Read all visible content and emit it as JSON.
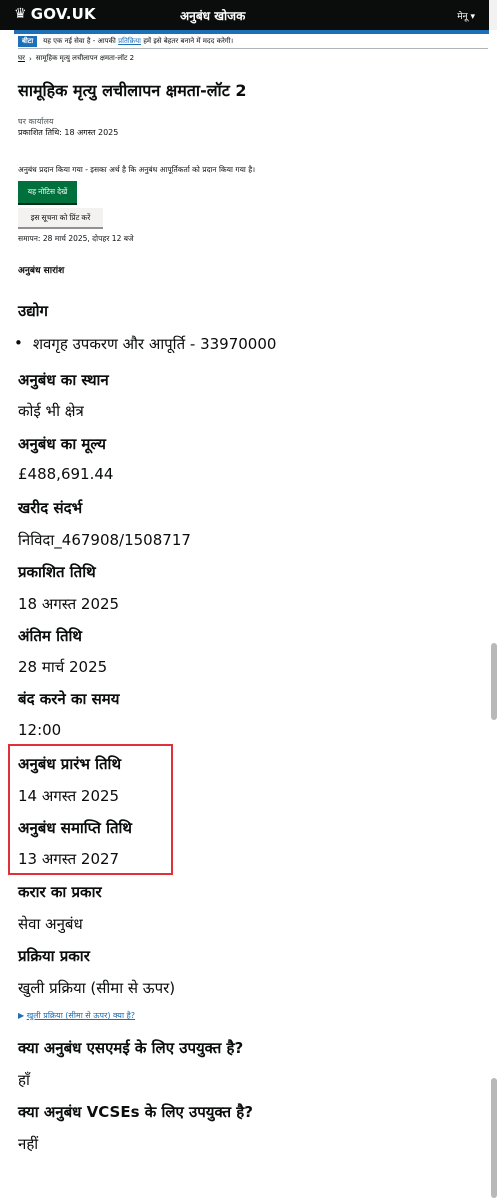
{
  "header": {
    "brand": "GOV.UK",
    "service": "अनुबंध खोजक",
    "menu_label": "मेनू"
  },
  "beta_banner": {
    "tag": "बीटा",
    "text_before": "यह एक नई सेवा है - आपकी",
    "link": "प्रतिक्रिया",
    "text_after": "हमें इसे बेहतर बनाने में मदद करेगी।"
  },
  "breadcrumb": {
    "home": "घर",
    "current": "सामूहिक मृत्यु लचीलापन क्षमता-लॉट 2"
  },
  "page": {
    "title": "सामूहिक मृत्यु लचीलापन क्षमता-लॉट 2",
    "office": "घर कार्यालय",
    "published": "प्रकाशित तिथि: 18 अगस्त 2025",
    "awarded_note": "अनुबंध प्रदान किया गया - इसका अर्थ है कि अनुबंध आपूर्तिकर्ता को प्रदान किया गया है।",
    "view_notice": "यह नोटिस देखें",
    "print_notice": "इस सूचना को प्रिंट करें",
    "closing": "समापन: 28 मार्च 2025, दोपहर 12 बजे",
    "summary_heading": "अनुबंध सारांश"
  },
  "fields": {
    "industry_h": "उद्योग",
    "industry_v": "शवगृह उपकरण और आपूर्ति - 33970000",
    "location_h": "अनुबंध का स्थान",
    "location_v": "कोई भी क्षेत्र",
    "value_h": "अनुबंध का मूल्य",
    "value_v": "£488,691.44",
    "ref_h": "खरीद संदर्भ",
    "ref_v": "निविदा_467908/1508717",
    "pub_h": "प्रकाशित तिथि",
    "pub_v": "18 अगस्त 2025",
    "deadline_h": "अंतिम तिथि",
    "deadline_v": "28 मार्च 2025",
    "closetime_h": "बंद करने का समय",
    "closetime_v": "12:00",
    "start_h": "अनुबंध प्रारंभ तिथि",
    "start_v": "14 अगस्त 2025",
    "end_h": "अनुबंध समाप्ति तिथि",
    "end_v": "13 अगस्त 2027",
    "type_h": "करार का प्रकार",
    "type_v": "सेवा अनुबंध",
    "proc_h": "प्रक्रिया प्रकार",
    "proc_v": "खुली प्रक्रिया (सीमा से ऊपर)",
    "proc_details": "खुली प्रक्रिया (सीमा से ऊपर) क्या है?",
    "sme_h": "क्या अनुबंध एसएमई के लिए उपयुक्त है?",
    "sme_v": "हाँ",
    "vcse_h": "क्या अनुबंध VCSEs के लिए उपयुक्त है?",
    "vcse_v": "नहीं"
  },
  "colors": {
    "header_bg": "#0b0c0c",
    "brand_blue": "#1d70b8",
    "button_green": "#00703c",
    "highlight_red": "#e0303a"
  }
}
